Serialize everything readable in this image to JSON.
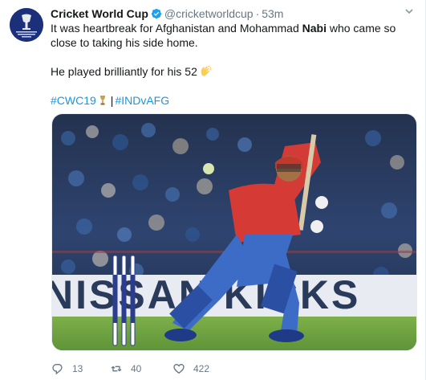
{
  "account": {
    "display_name": "Cricket World Cup",
    "handle": "@cricketworldcup",
    "separator": "·",
    "time": "53m",
    "avatar_icon": "cwc19-logo-icon",
    "avatar_logo_text": "ICC Cricket World Cup England & Wales 2019",
    "verified_icon": "verified-badge-icon"
  },
  "tweet": {
    "text_line1_before": "It was heartbreak for Afghanistan and Mohammad ",
    "text_line1_bold": "Nabi",
    "text_line1_after": " who came so close to taking his side home.",
    "text_line2": "He played brilliantly for his 52",
    "clap_emoji": "clapping-hands-icon",
    "hashtags": [
      "#CWC19",
      "#INDvAFG"
    ],
    "hashtag_separator": "|",
    "trophy_emoji": "trophy-icon"
  },
  "media": {
    "image_icon": "cricket-batsman-photo",
    "banner_text": "NISSAN KICKS"
  },
  "actions": {
    "reply_count": "13",
    "retweet_count": "40",
    "like_count": "422",
    "reply_icon": "reply-icon",
    "retweet_icon": "retweet-icon",
    "like_icon": "heart-icon"
  },
  "colors": {
    "link": "#1b95e0",
    "muted": "#657786",
    "text": "#14171a",
    "verified": "#1da1f2"
  }
}
